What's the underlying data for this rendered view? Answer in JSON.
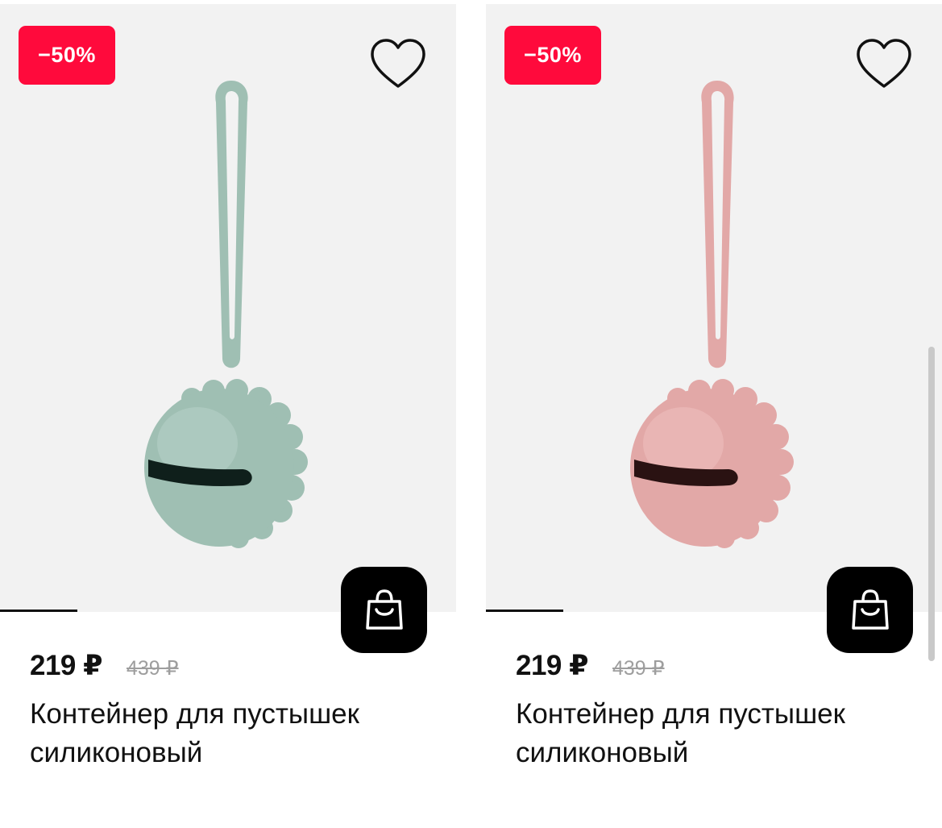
{
  "products": [
    {
      "badge": "−50%",
      "price": "219 ₽",
      "old_price": "439 ₽",
      "title": "Контейнер для пустышек силиконовый",
      "color": "#9fbfb3",
      "color_dark": "#86a99c",
      "color_light": "#b5d0c6"
    },
    {
      "badge": "−50%",
      "price": "219 ₽",
      "old_price": "439 ₽",
      "title": "Контейнер для пустышек силиконовый",
      "color": "#e2a8a7",
      "color_dark": "#cc8f8e",
      "color_light": "#efbebc"
    }
  ],
  "icons": {
    "favorite": "heart-icon",
    "cart": "shopping-bag-icon"
  },
  "colors": {
    "badge_bg": "#ff0a3c",
    "cart_bg": "#000000",
    "image_bg": "#f2f2f2"
  }
}
